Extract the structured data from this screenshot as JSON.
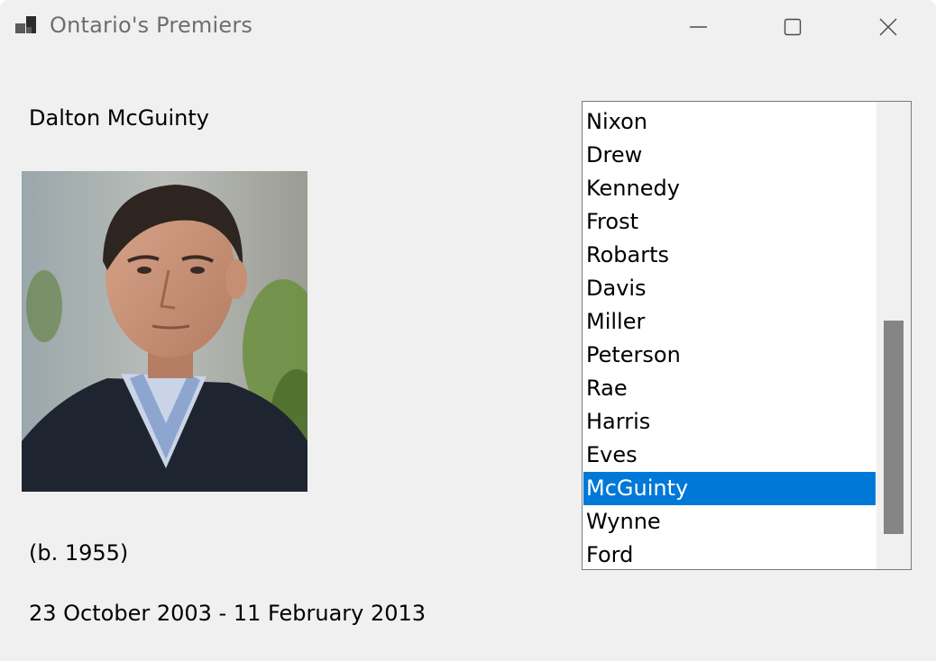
{
  "window": {
    "title": "Ontario's Premiers",
    "app_icon": "app-windows-icon",
    "controls": [
      "minimize-icon",
      "maximize-icon",
      "close-icon"
    ]
  },
  "details": {
    "name": "Dalton McGuinty",
    "photo": "portrait-photo",
    "born": "(b. 1955)",
    "term": "23 October 2003 - 11 February 2013"
  },
  "premiers_list": {
    "items": [
      "Nixon",
      "Drew",
      "Kennedy",
      "Frost",
      "Robarts",
      "Davis",
      "Miller",
      "Peterson",
      "Rae",
      "Harris",
      "Eves",
      "McGuinty",
      "Wynne",
      "Ford"
    ],
    "selected": "McGuinty",
    "selection_color": "#0078d7"
  }
}
